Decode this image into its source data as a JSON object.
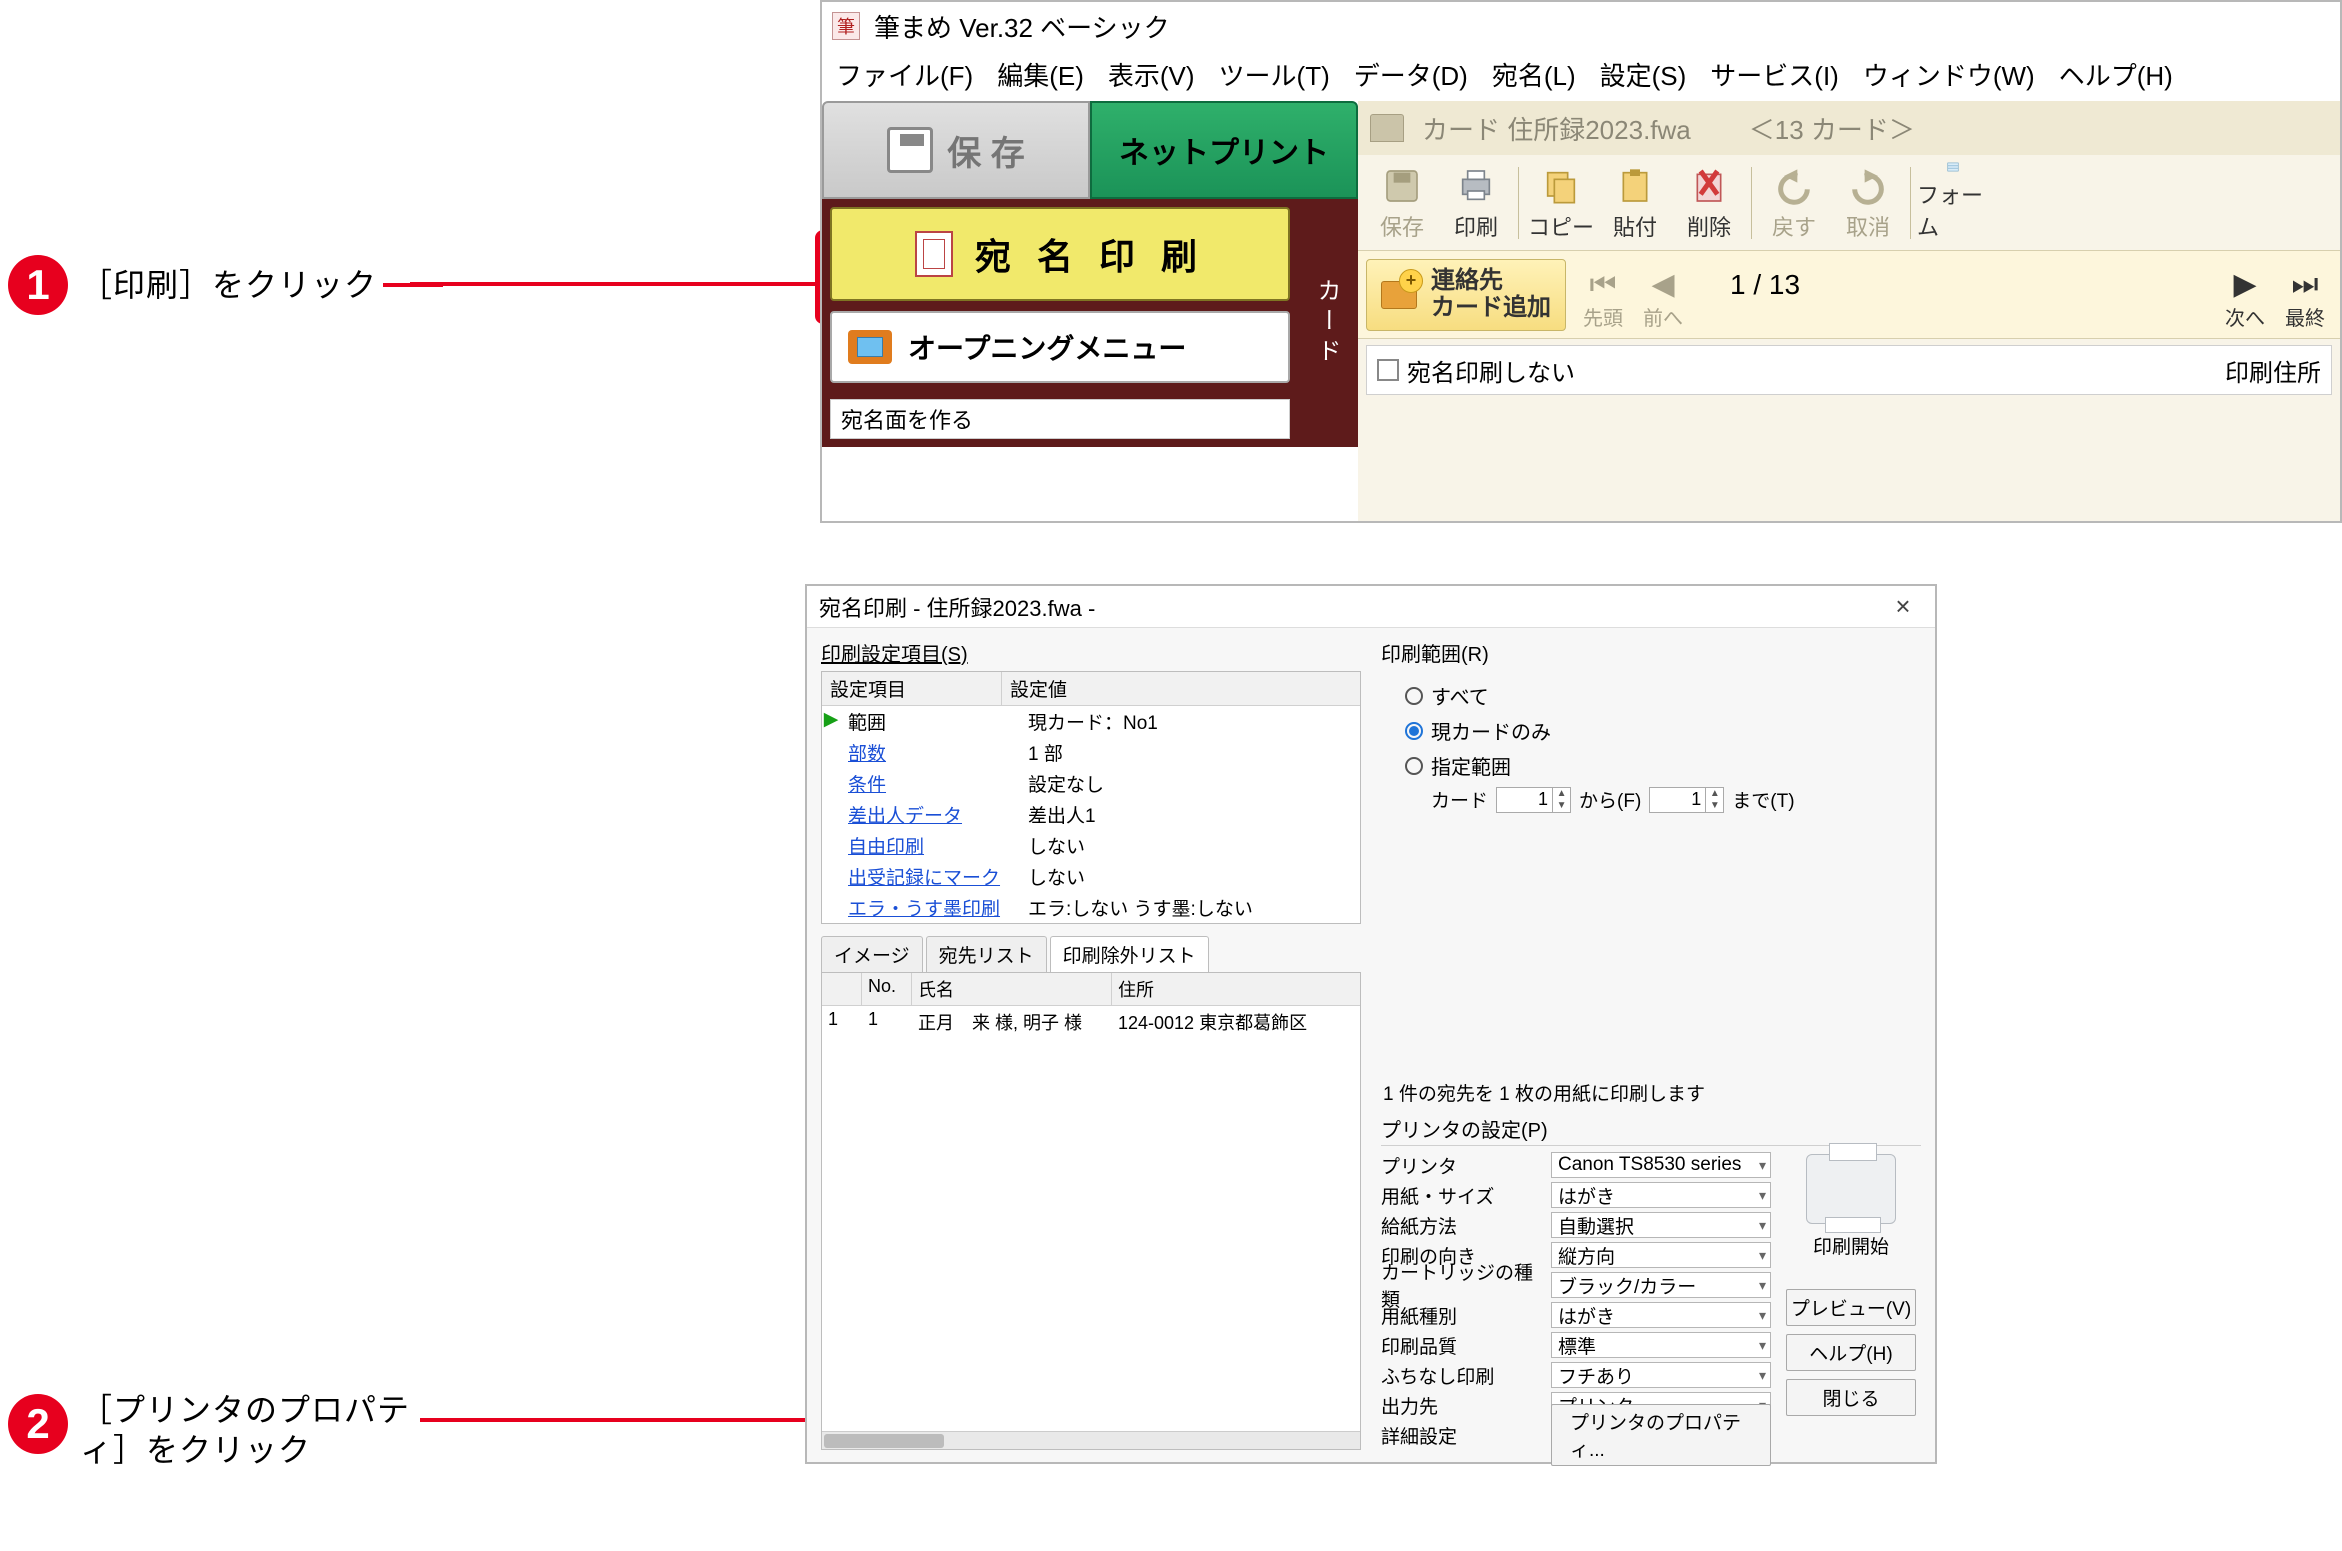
{
  "callouts": {
    "c1_num": "1",
    "c1_text": "［印刷］をクリック",
    "c2_num": "2",
    "c2_text": "［プリンタのプロパティ］をクリック"
  },
  "app": {
    "title": "筆まめ Ver.32 ベーシック",
    "menu": {
      "file": "ファイル(F)",
      "edit": "編集(E)",
      "view": "表示(V)",
      "tool": "ツール(T)",
      "data": "データ(D)",
      "atena": "宛名(L)",
      "settings": "設定(S)",
      "service": "サービス(I)",
      "window": "ウィンドウ(W)",
      "help": "ヘルプ(H)"
    },
    "left": {
      "save": "保 存",
      "netprint": "ネットプリント",
      "atena_print": "宛 名 印 刷",
      "opening": "オープニングメニュー",
      "side_tab": "カード",
      "bottom_frag": "宛名面を作る"
    },
    "card": {
      "doc": "カード  住所録2023.fwa",
      "count_badge": "＜13 カード＞",
      "toolbar": {
        "save": "保存",
        "print": "印刷",
        "copy": "コピー",
        "paste": "貼付",
        "delete": "削除",
        "undo": "戻す",
        "redo": "取消",
        "form": "フォーム"
      },
      "addcontact_l1": "連絡先",
      "addcontact_l2": "カード追加",
      "nav": {
        "first": "先頭",
        "prev": "前へ",
        "page": "1 /  13",
        "next": "次へ",
        "last": "最終"
      },
      "noprint_chk": "宛名印刷しない",
      "rightlabel": "印刷住所"
    }
  },
  "dlg": {
    "title": "宛名印刷 - 住所録2023.fwa -",
    "close": "×",
    "left": {
      "section": "印刷設定項目(S)",
      "hdr_key": "設定項目",
      "hdr_val": "設定値",
      "rows": [
        {
          "k": "範囲",
          "v": "現カード：No1",
          "sel": true
        },
        {
          "k": "部数",
          "v": "1 部"
        },
        {
          "k": "条件",
          "v": "設定なし"
        },
        {
          "k": "差出人データ",
          "v": "差出人1"
        },
        {
          "k": "自由印刷",
          "v": "しない"
        },
        {
          "k": "出受記録にマーク",
          "v": "しない"
        },
        {
          "k": "エラ・うす墨印刷",
          "v": "エラ:しない うす墨:しない"
        }
      ],
      "tabs": {
        "image": "イメージ",
        "list": "宛先リスト",
        "excl": "印刷除外リスト"
      },
      "list_hdr": {
        "idx": "",
        "no": "No.",
        "name": "氏名",
        "addr": "住所"
      },
      "list_row": {
        "idx": "1",
        "no": "1",
        "name": "正月　来 様, 明子 様",
        "addr": "124-0012 東京都葛飾区"
      }
    },
    "right": {
      "range_section": "印刷範囲(R)",
      "r_all": "すべて",
      "r_current": "現カードのみ",
      "r_range": "指定範囲",
      "card_lbl": "カード",
      "from_val": "1",
      "from_lbl": "から(F)",
      "to_val": "1",
      "to_lbl": "まで(T)",
      "status": "1 件の宛先を 1 枚の用紙に印刷します",
      "printer_section": "プリンタの設定(P)",
      "rows": {
        "printer_k": "プリンタ",
        "printer_v": "Canon TS8530 series",
        "paper_k": "用紙・サイズ",
        "paper_v": "はがき",
        "feed_k": "給紙方法",
        "feed_v": "自動選択",
        "orient_k": "印刷の向き",
        "orient_v": "縦方向",
        "cart_k": "カートリッジの種類",
        "cart_v": "ブラック/カラー",
        "media_k": "用紙種別",
        "media_v": "はがき",
        "quality_k": "印刷品質",
        "quality_v": "標準",
        "border_k": "ふちなし印刷",
        "border_v": "フチあり",
        "output_k": "出力先",
        "output_v": "プリンタ",
        "detail_k": "詳細設定"
      },
      "prop_btn": "プリンタのプロパティ...",
      "side": {
        "start": "印刷開始",
        "preview": "プレビュー(V)",
        "help": "ヘルプ(H)",
        "close": "閉じる"
      }
    }
  }
}
